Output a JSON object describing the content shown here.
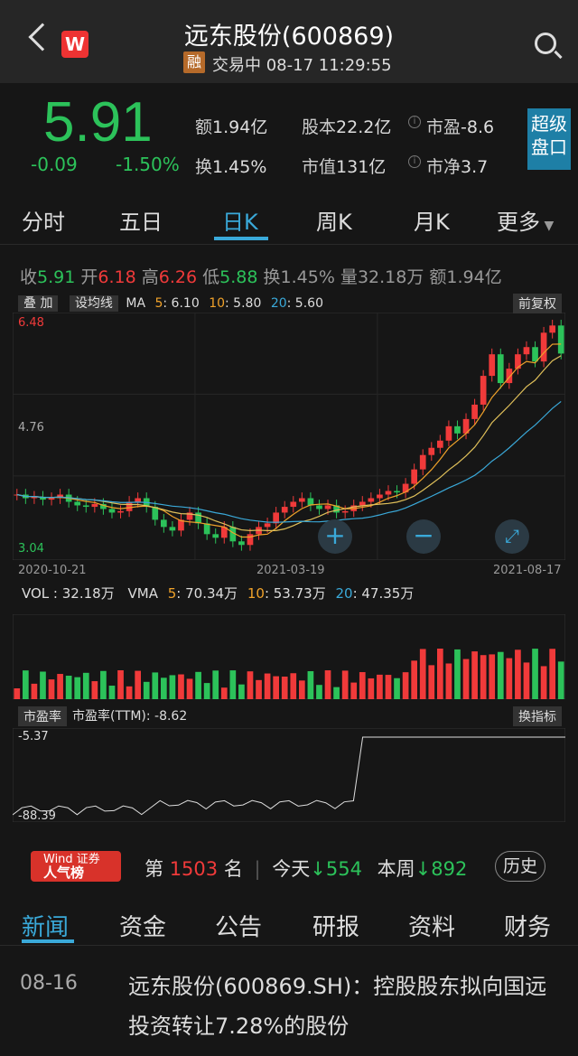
{
  "header": {
    "title": "远东股份(600869)",
    "badge": "融",
    "status": "交易中 08-17 11:29:55",
    "logo": "W"
  },
  "quote": {
    "price": "5.91",
    "change": "-0.09",
    "change_pct": "-1.50%",
    "amount_label": "额",
    "amount": "1.94亿",
    "turnover_label": "换",
    "turnover": "1.45%",
    "shares_label": "股本",
    "shares": "22.2亿",
    "mktcap_label": "市值",
    "mktcap": "131亿",
    "pe_label": "市盈",
    "pe": "-8.6",
    "pb_label": "市净",
    "pb": "3.7",
    "super_btn": "超级盘口"
  },
  "tabs": [
    "分时",
    "五日",
    "日K",
    "周K",
    "月K",
    "更多"
  ],
  "info_line": {
    "close_label": "收",
    "close": "5.91",
    "open_label": "开",
    "open": "6.18",
    "high_label": "高",
    "high": "6.26",
    "low_label": "低",
    "low": "5.88",
    "turn_label": "换",
    "turn": "1.45%",
    "vol_label": "量",
    "vol": "32.18万",
    "amt_label": "额",
    "amt": "1.94亿"
  },
  "ma_line": {
    "btn_overlay": "叠 加",
    "btn_ma": "设均线",
    "ma": "MA",
    "ma5_label": "5",
    "ma5": ": 6.10",
    "ma10_label": "10",
    "ma10": ": 5.80",
    "ma20_label": "20",
    "ma20": ": 5.60",
    "restore": "前复权"
  },
  "chart_data": [
    {
      "type": "candlestick",
      "yaxis_ticks": [
        "6.48",
        "4.76",
        "3.04"
      ],
      "x_ticks": [
        "2020-10-21",
        "2021-03-19",
        "2021-08-17"
      ],
      "close_series": [
        3.95,
        3.9,
        3.92,
        3.88,
        3.9,
        3.95,
        3.85,
        3.8,
        3.78,
        3.82,
        3.75,
        3.7,
        3.72,
        3.85,
        3.9,
        3.78,
        3.6,
        3.5,
        3.45,
        3.6,
        3.7,
        3.55,
        3.4,
        3.35,
        3.5,
        3.3,
        3.25,
        3.4,
        3.5,
        3.55,
        3.7,
        3.78,
        3.85,
        3.9,
        3.8,
        3.75,
        3.8,
        3.7,
        3.72,
        3.8,
        3.85,
        3.9,
        3.95,
        4.0,
        3.98,
        4.1,
        4.3,
        4.5,
        4.6,
        4.7,
        4.9,
        4.8,
        5.0,
        5.2,
        5.6,
        5.9,
        5.5,
        5.7,
        5.9,
        6.0,
        5.8,
        6.2,
        6.3,
        5.91
      ]
    },
    {
      "type": "bar",
      "label": "VOL",
      "vol": "32.18万",
      "vma5": "70.34万",
      "vma10": "53.73万",
      "vma20": "47.35万"
    },
    {
      "type": "line",
      "label": "市盈率",
      "ttm": "-8.62",
      "ymax": "-5.37",
      "ymin": "-88.39"
    }
  ],
  "vol_line": {
    "label": "VOL :",
    "value": "32.18万",
    "vma": "VMA",
    "v5_label": "5",
    "v5": ": 70.34万",
    "v10_label": "10",
    "v10": ": 53.73万",
    "v20_label": "20",
    "v20": ": 47.35万"
  },
  "pe_line": {
    "btn": "市盈率",
    "ttm": "市盈率(TTM): -8.62",
    "switch": "换指标",
    "top": "-5.37",
    "bottom": "-88.39"
  },
  "rank": {
    "badge_top": "Wind 证券",
    "badge_bottom": "人气榜",
    "prefix": "第",
    "num": "1503",
    "suffix": "名",
    "today_label": "今天",
    "today": "554",
    "week_label": "本周",
    "week": "892",
    "history": "历史"
  },
  "news_tabs": [
    "新闻",
    "资金",
    "公告",
    "研报",
    "资料",
    "财务"
  ],
  "news": {
    "date": "08-16",
    "title": "远东股份(600869.SH)：控股股东拟向国远投资转让7.28%的股份"
  }
}
